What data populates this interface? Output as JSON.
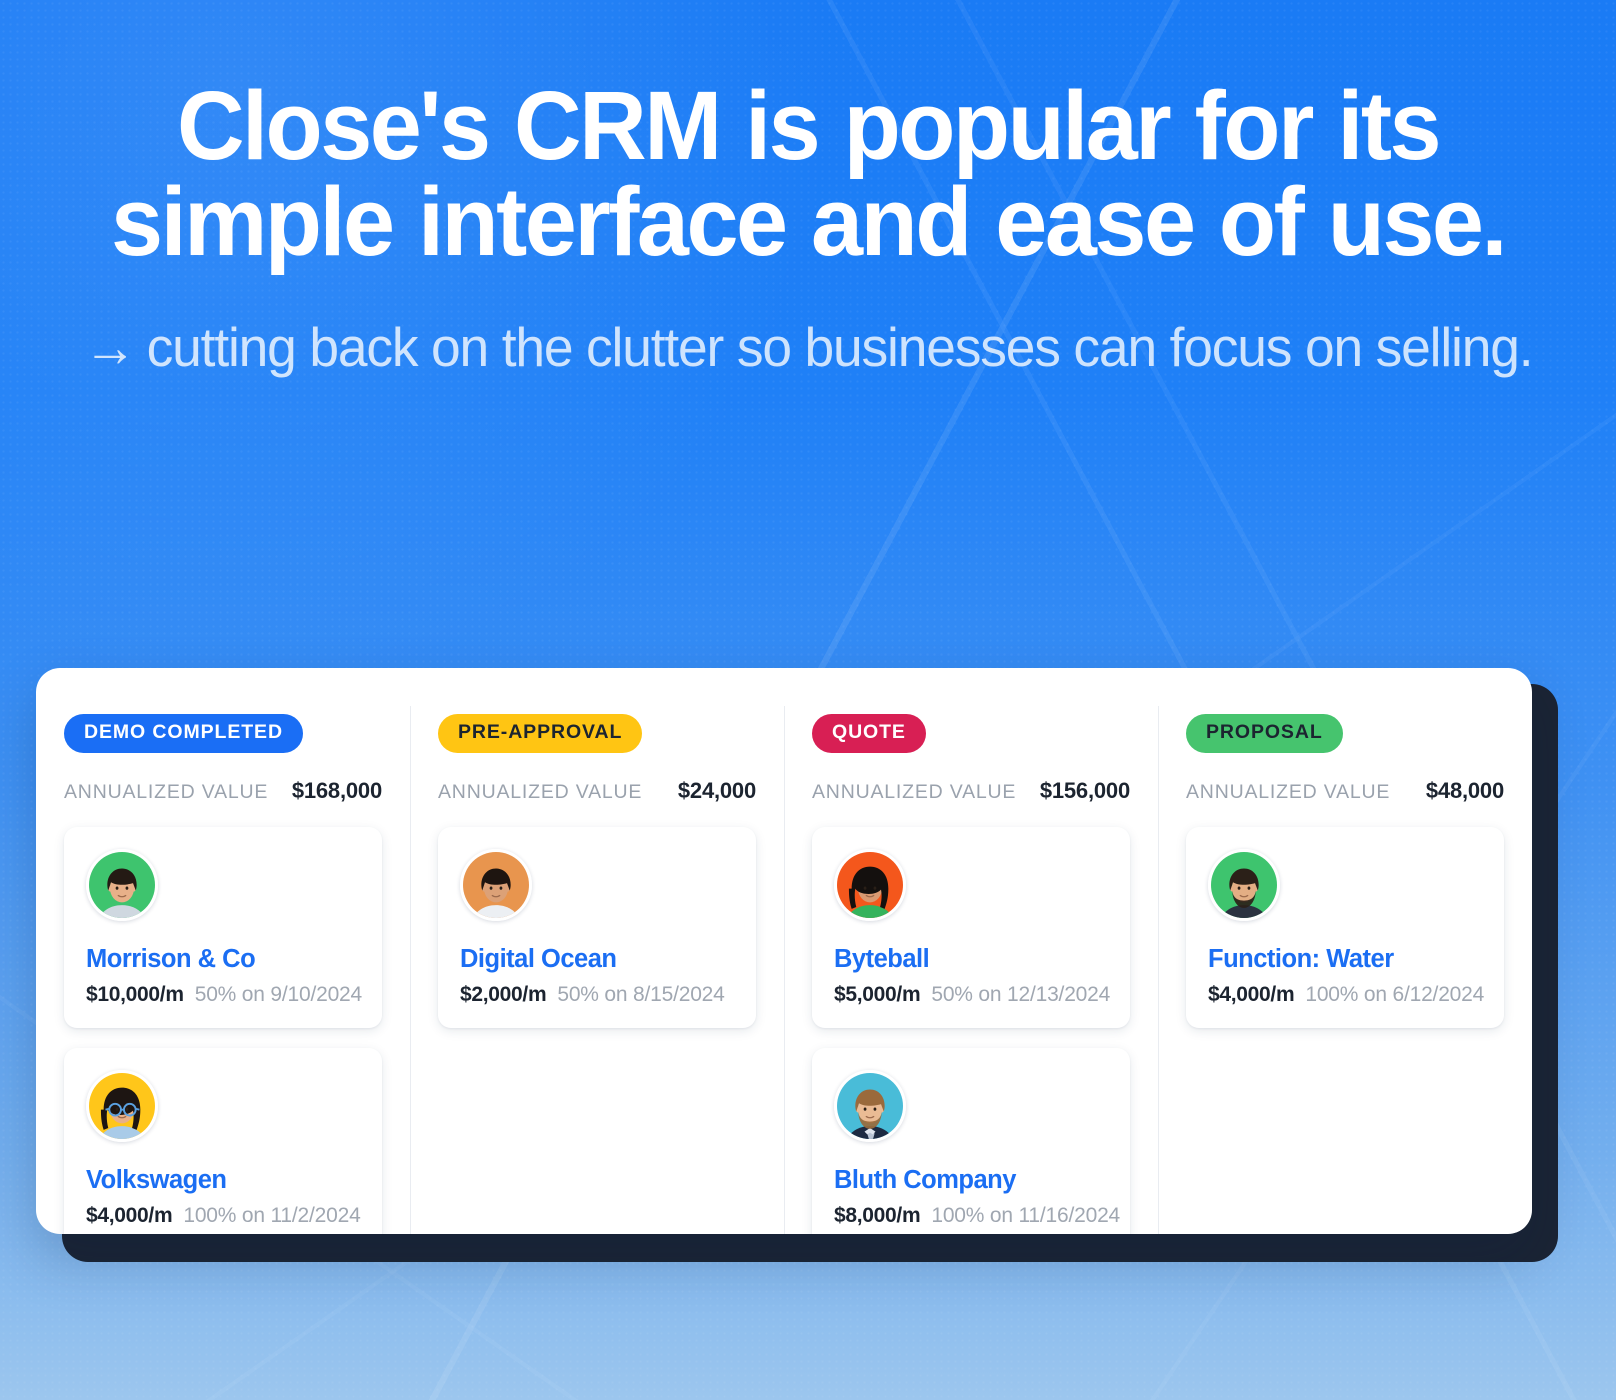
{
  "hero": {
    "headline": "Close's CRM is popular for its simple interface and ease of use.",
    "subhead_arrow": "→",
    "subhead": "cutting back on the clutter so businesses can focus on selling."
  },
  "app": {
    "value_label": "ANNUALIZED VALUE",
    "columns": [
      {
        "stage": "DEMO COMPLETED",
        "badge_bg": "#1a6ef5",
        "badge_fg": "#ffffff",
        "annualized_value": "$168,000",
        "leads": [
          {
            "name": "Morrison & Co",
            "mrr": "$10,000/m",
            "probability": "50% on 9/10/2024",
            "avatar": "avatar-green-man"
          },
          {
            "name": "Volkswagen",
            "mrr": "$4,000/m",
            "probability": "100% on 11/2/2024",
            "avatar": "avatar-yellow-woman-glasses"
          }
        ]
      },
      {
        "stage": "PRE-APPROVAL",
        "badge_bg": "#ffc513",
        "badge_fg": "#1c2430",
        "annualized_value": "$24,000",
        "leads": [
          {
            "name": "Digital Ocean",
            "mrr": "$2,000/m",
            "probability": "50% on 8/15/2024",
            "avatar": "avatar-orange-man"
          }
        ]
      },
      {
        "stage": "QUOTE",
        "badge_bg": "#d81f54",
        "badge_fg": "#ffffff",
        "annualized_value": "$156,000",
        "leads": [
          {
            "name": "Byteball",
            "mrr": "$5,000/m",
            "probability": "50% on 12/13/2024",
            "avatar": "avatar-red-woman"
          },
          {
            "name": "Bluth Company",
            "mrr": "$8,000/m",
            "probability": "100% on 11/16/2024",
            "avatar": "avatar-cyan-man-suit"
          }
        ]
      },
      {
        "stage": "PROPOSAL",
        "badge_bg": "#46c46e",
        "badge_fg": "#1c2430",
        "annualized_value": "$48,000",
        "leads": [
          {
            "name": "Function: Water",
            "mrr": "$4,000/m",
            "probability": "100% on 6/12/2024",
            "avatar": "avatar-green-man-beard"
          }
        ]
      }
    ]
  },
  "colors": {
    "bg_top": "#1a7bf5",
    "bg_bottom": "#9cc6ee",
    "link_blue": "#1b6ef3",
    "text_dark": "#1c2430",
    "text_muted": "#9aa2ad",
    "frame_dark": "#1b2434"
  }
}
